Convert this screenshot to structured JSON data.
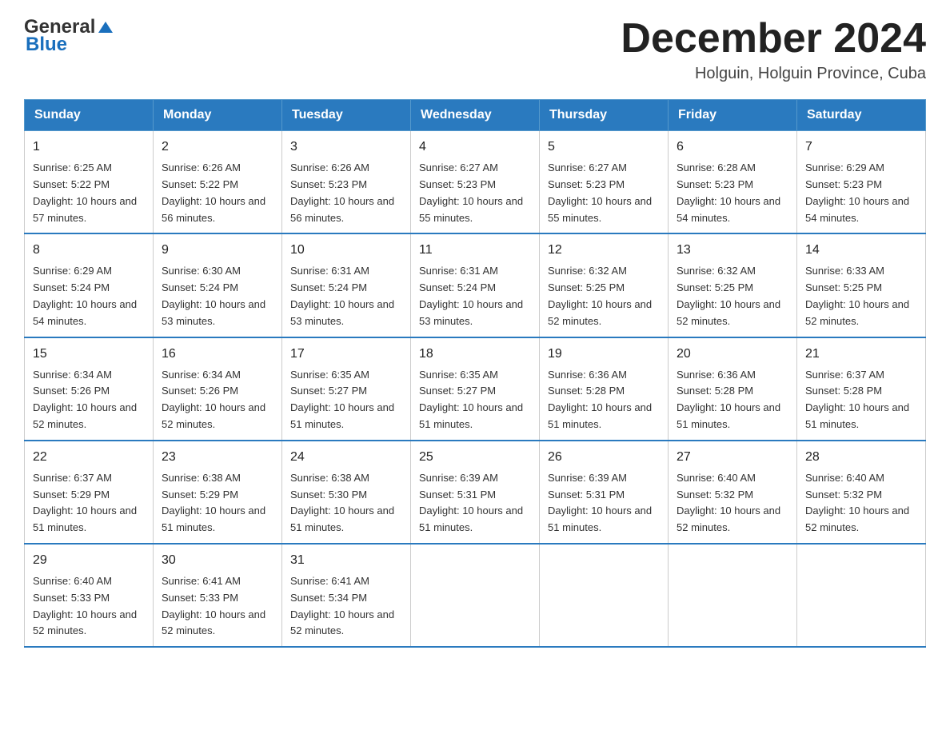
{
  "header": {
    "logo": {
      "general": "General",
      "blue": "Blue",
      "arrow": "▼"
    },
    "title": "December 2024",
    "location": "Holguin, Holguin Province, Cuba"
  },
  "weekdays": [
    "Sunday",
    "Monday",
    "Tuesday",
    "Wednesday",
    "Thursday",
    "Friday",
    "Saturday"
  ],
  "weeks": [
    [
      {
        "day": "1",
        "sunrise": "Sunrise: 6:25 AM",
        "sunset": "Sunset: 5:22 PM",
        "daylight": "Daylight: 10 hours and 57 minutes."
      },
      {
        "day": "2",
        "sunrise": "Sunrise: 6:26 AM",
        "sunset": "Sunset: 5:22 PM",
        "daylight": "Daylight: 10 hours and 56 minutes."
      },
      {
        "day": "3",
        "sunrise": "Sunrise: 6:26 AM",
        "sunset": "Sunset: 5:23 PM",
        "daylight": "Daylight: 10 hours and 56 minutes."
      },
      {
        "day": "4",
        "sunrise": "Sunrise: 6:27 AM",
        "sunset": "Sunset: 5:23 PM",
        "daylight": "Daylight: 10 hours and 55 minutes."
      },
      {
        "day": "5",
        "sunrise": "Sunrise: 6:27 AM",
        "sunset": "Sunset: 5:23 PM",
        "daylight": "Daylight: 10 hours and 55 minutes."
      },
      {
        "day": "6",
        "sunrise": "Sunrise: 6:28 AM",
        "sunset": "Sunset: 5:23 PM",
        "daylight": "Daylight: 10 hours and 54 minutes."
      },
      {
        "day": "7",
        "sunrise": "Sunrise: 6:29 AM",
        "sunset": "Sunset: 5:23 PM",
        "daylight": "Daylight: 10 hours and 54 minutes."
      }
    ],
    [
      {
        "day": "8",
        "sunrise": "Sunrise: 6:29 AM",
        "sunset": "Sunset: 5:24 PM",
        "daylight": "Daylight: 10 hours and 54 minutes."
      },
      {
        "day": "9",
        "sunrise": "Sunrise: 6:30 AM",
        "sunset": "Sunset: 5:24 PM",
        "daylight": "Daylight: 10 hours and 53 minutes."
      },
      {
        "day": "10",
        "sunrise": "Sunrise: 6:31 AM",
        "sunset": "Sunset: 5:24 PM",
        "daylight": "Daylight: 10 hours and 53 minutes."
      },
      {
        "day": "11",
        "sunrise": "Sunrise: 6:31 AM",
        "sunset": "Sunset: 5:24 PM",
        "daylight": "Daylight: 10 hours and 53 minutes."
      },
      {
        "day": "12",
        "sunrise": "Sunrise: 6:32 AM",
        "sunset": "Sunset: 5:25 PM",
        "daylight": "Daylight: 10 hours and 52 minutes."
      },
      {
        "day": "13",
        "sunrise": "Sunrise: 6:32 AM",
        "sunset": "Sunset: 5:25 PM",
        "daylight": "Daylight: 10 hours and 52 minutes."
      },
      {
        "day": "14",
        "sunrise": "Sunrise: 6:33 AM",
        "sunset": "Sunset: 5:25 PM",
        "daylight": "Daylight: 10 hours and 52 minutes."
      }
    ],
    [
      {
        "day": "15",
        "sunrise": "Sunrise: 6:34 AM",
        "sunset": "Sunset: 5:26 PM",
        "daylight": "Daylight: 10 hours and 52 minutes."
      },
      {
        "day": "16",
        "sunrise": "Sunrise: 6:34 AM",
        "sunset": "Sunset: 5:26 PM",
        "daylight": "Daylight: 10 hours and 52 minutes."
      },
      {
        "day": "17",
        "sunrise": "Sunrise: 6:35 AM",
        "sunset": "Sunset: 5:27 PM",
        "daylight": "Daylight: 10 hours and 51 minutes."
      },
      {
        "day": "18",
        "sunrise": "Sunrise: 6:35 AM",
        "sunset": "Sunset: 5:27 PM",
        "daylight": "Daylight: 10 hours and 51 minutes."
      },
      {
        "day": "19",
        "sunrise": "Sunrise: 6:36 AM",
        "sunset": "Sunset: 5:28 PM",
        "daylight": "Daylight: 10 hours and 51 minutes."
      },
      {
        "day": "20",
        "sunrise": "Sunrise: 6:36 AM",
        "sunset": "Sunset: 5:28 PM",
        "daylight": "Daylight: 10 hours and 51 minutes."
      },
      {
        "day": "21",
        "sunrise": "Sunrise: 6:37 AM",
        "sunset": "Sunset: 5:28 PM",
        "daylight": "Daylight: 10 hours and 51 minutes."
      }
    ],
    [
      {
        "day": "22",
        "sunrise": "Sunrise: 6:37 AM",
        "sunset": "Sunset: 5:29 PM",
        "daylight": "Daylight: 10 hours and 51 minutes."
      },
      {
        "day": "23",
        "sunrise": "Sunrise: 6:38 AM",
        "sunset": "Sunset: 5:29 PM",
        "daylight": "Daylight: 10 hours and 51 minutes."
      },
      {
        "day": "24",
        "sunrise": "Sunrise: 6:38 AM",
        "sunset": "Sunset: 5:30 PM",
        "daylight": "Daylight: 10 hours and 51 minutes."
      },
      {
        "day": "25",
        "sunrise": "Sunrise: 6:39 AM",
        "sunset": "Sunset: 5:31 PM",
        "daylight": "Daylight: 10 hours and 51 minutes."
      },
      {
        "day": "26",
        "sunrise": "Sunrise: 6:39 AM",
        "sunset": "Sunset: 5:31 PM",
        "daylight": "Daylight: 10 hours and 51 minutes."
      },
      {
        "day": "27",
        "sunrise": "Sunrise: 6:40 AM",
        "sunset": "Sunset: 5:32 PM",
        "daylight": "Daylight: 10 hours and 52 minutes."
      },
      {
        "day": "28",
        "sunrise": "Sunrise: 6:40 AM",
        "sunset": "Sunset: 5:32 PM",
        "daylight": "Daylight: 10 hours and 52 minutes."
      }
    ],
    [
      {
        "day": "29",
        "sunrise": "Sunrise: 6:40 AM",
        "sunset": "Sunset: 5:33 PM",
        "daylight": "Daylight: 10 hours and 52 minutes."
      },
      {
        "day": "30",
        "sunrise": "Sunrise: 6:41 AM",
        "sunset": "Sunset: 5:33 PM",
        "daylight": "Daylight: 10 hours and 52 minutes."
      },
      {
        "day": "31",
        "sunrise": "Sunrise: 6:41 AM",
        "sunset": "Sunset: 5:34 PM",
        "daylight": "Daylight: 10 hours and 52 minutes."
      },
      {
        "day": "",
        "sunrise": "",
        "sunset": "",
        "daylight": ""
      },
      {
        "day": "",
        "sunrise": "",
        "sunset": "",
        "daylight": ""
      },
      {
        "day": "",
        "sunrise": "",
        "sunset": "",
        "daylight": ""
      },
      {
        "day": "",
        "sunrise": "",
        "sunset": "",
        "daylight": ""
      }
    ]
  ]
}
